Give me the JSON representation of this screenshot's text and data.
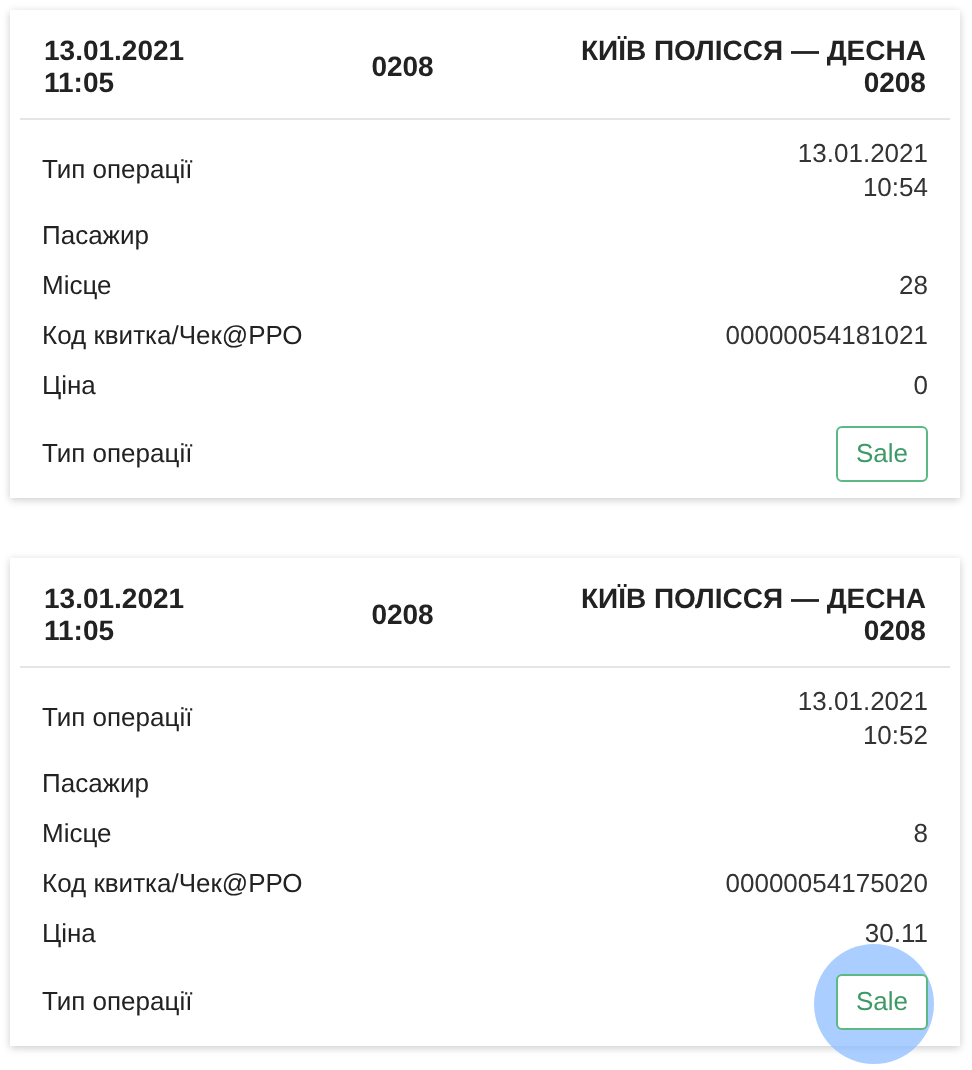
{
  "tickets": [
    {
      "date": "13.01.2021",
      "time": "11:05",
      "code": "0208",
      "route": "КИЇВ ПОЛІССЯ — ДЕСНА",
      "route_code": "0208",
      "rows": [
        {
          "kind": "text",
          "label": "Тип операції",
          "value": "13.01.2021",
          "value_2": "10:54"
        },
        {
          "kind": "text",
          "label": "Пасажир"
        },
        {
          "kind": "text",
          "label": "Місце",
          "value": "28"
        },
        {
          "kind": "text",
          "label": "Код квитка/Чек@РРО",
          "value": "00000054181021"
        },
        {
          "kind": "text",
          "label": "Ціна",
          "value": "0"
        },
        {
          "kind": "button",
          "label": "Тип операції",
          "value": "Sale"
        }
      ]
    },
    {
      "date": "13.01.2021",
      "time": "11:05",
      "code": "0208",
      "route": "КИЇВ ПОЛІССЯ — ДЕСНА",
      "route_code": "0208",
      "rows": [
        {
          "kind": "text",
          "label": "Тип операції",
          "value": "13.01.2021",
          "value_2": "10:52"
        },
        {
          "kind": "text",
          "label": "Пасажир"
        },
        {
          "kind": "text",
          "label": "Місце",
          "value": "8"
        },
        {
          "kind": "text",
          "label": "Код квитка/Чек@РРО",
          "value": "00000054175020"
        },
        {
          "kind": "text",
          "label": "Ціна",
          "value": "30.11"
        },
        {
          "kind": "button",
          "label": "Тип операції",
          "value": "Sale"
        }
      ]
    }
  ]
}
